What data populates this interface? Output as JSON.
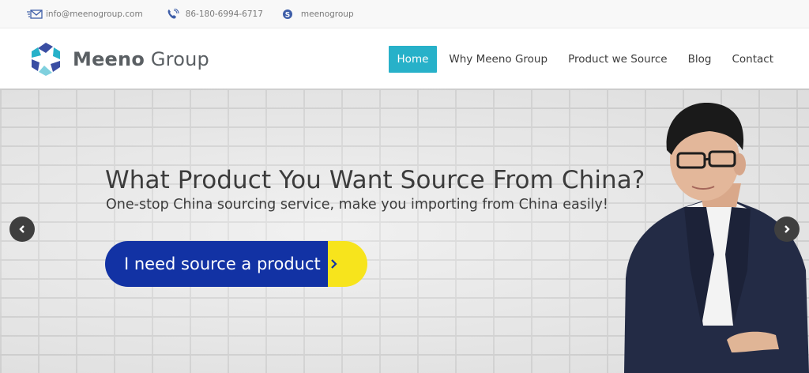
{
  "topbar": {
    "email": "info@meenogroup.com",
    "phone": "86-180-6994-6717",
    "skype": "meenogroup",
    "icons": [
      "email-icon",
      "phone-icon",
      "skype-icon"
    ]
  },
  "logo": {
    "name_strong": "Meeno",
    "name_light": "Group"
  },
  "nav": {
    "items": [
      {
        "label": "Home",
        "active": true
      },
      {
        "label": "Why Meeno Group",
        "active": false
      },
      {
        "label": "Product we Source",
        "active": false
      },
      {
        "label": "Blog",
        "active": false
      },
      {
        "label": "Contact",
        "active": false
      }
    ]
  },
  "hero": {
    "title": "What Product You Want Source From China?",
    "subtitle": "One-stop China sourcing service, make you importing from China easily!",
    "cta_label": "I need source a product",
    "colors": {
      "cta_blue": "#1232a4",
      "cta_yellow": "#f7e41c",
      "accent": "#27b1c9"
    }
  }
}
